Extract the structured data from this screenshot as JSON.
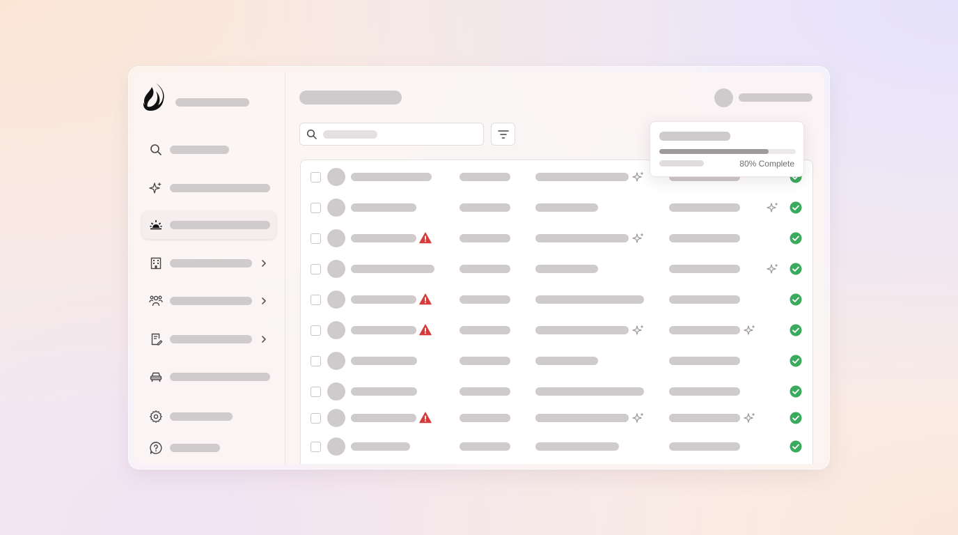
{
  "sidebar": {
    "items": [
      {
        "icon": "search-icon"
      },
      {
        "icon": "sparkles-icon"
      },
      {
        "icon": "sunrise-icon",
        "active": true
      },
      {
        "icon": "building-icon",
        "has_chevron": true
      },
      {
        "icon": "users-icon",
        "has_chevron": true
      },
      {
        "icon": "document-edit-icon",
        "has_chevron": true
      },
      {
        "icon": "car-icon"
      },
      {
        "icon": "gear-icon"
      },
      {
        "icon": "help-icon"
      }
    ]
  },
  "toolbar": {
    "search_placeholder": "",
    "search_value": ""
  },
  "progress_popup": {
    "progress": 0.8,
    "label": "80% Complete"
  },
  "table": {
    "rows": [
      {
        "warning": false,
        "spark_col3": true,
        "spark_col4": false,
        "status": "complete"
      },
      {
        "warning": false,
        "spark_col3": false,
        "spark_col4": true,
        "status": "complete"
      },
      {
        "warning": true,
        "spark_col3": true,
        "spark_col4": false,
        "status": "complete"
      },
      {
        "warning": false,
        "spark_col3": false,
        "spark_col4": true,
        "status": "complete"
      },
      {
        "warning": true,
        "spark_col3": false,
        "spark_col4": false,
        "status": "complete"
      },
      {
        "warning": true,
        "spark_col3": true,
        "spark_col4": true,
        "status": "complete"
      },
      {
        "warning": false,
        "spark_col3": false,
        "spark_col4": false,
        "status": "complete"
      },
      {
        "warning": false,
        "spark_col3": false,
        "spark_col4": false,
        "status": "complete"
      },
      {
        "warning": true,
        "spark_col3": true,
        "spark_col4": true,
        "status": "complete"
      },
      {
        "warning": false,
        "spark_col3": false,
        "spark_col4": false,
        "status": "complete"
      }
    ]
  },
  "colors": {
    "warning": "#d63b3b",
    "success": "#3aaa5c",
    "placeholder": "#cfcacb"
  }
}
